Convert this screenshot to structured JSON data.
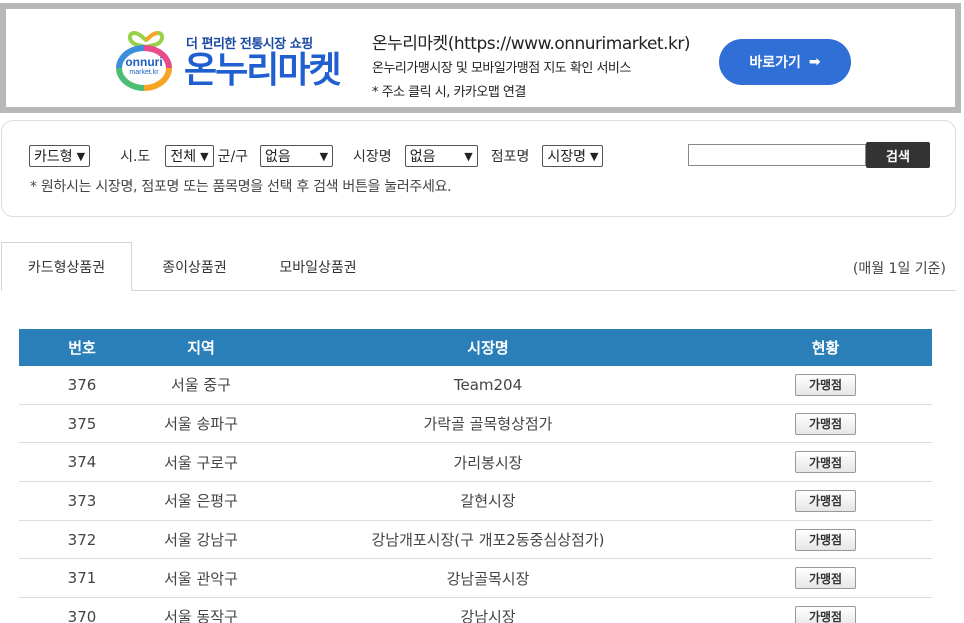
{
  "banner": {
    "logo_en": "onnuri",
    "logo_en_sub": "market.kr",
    "tagline": "더 편리한 전통시장 쇼핑",
    "brand": "온누리마켓",
    "info_title": "온누리마켓(https://www.onnurimarket.kr)",
    "info_sub": "온누리가맹시장 및 모바일가맹점 지도 확인 서비스",
    "info_note": "* 주소 클릭 시, 카카오맵 연결",
    "goto_label": "바로가기",
    "goto_arrow": "➡",
    "colors": {
      "brand": "#1f5fd0",
      "button": "#2f6fd6",
      "frame": "#b8b8b8"
    }
  },
  "search": {
    "type_select": "카드형",
    "sido_label": "시.도",
    "sido_select": "전체",
    "gugun_label": "군/구",
    "gugun_select": "없음",
    "market_label": "시장명",
    "market_select": "없음",
    "store_label": "점포명",
    "store_select": "시장명",
    "query_value": "",
    "button_label": "검색",
    "hint": "* 원하시는 시장명, 점포명 또는 품목명을 선택 후 검색 버튼을 눌러주세요."
  },
  "tabs": [
    {
      "label": "카드형상품권",
      "active": true
    },
    {
      "label": "종이상품권",
      "active": false
    },
    {
      "label": "모바일상품권",
      "active": false
    }
  ],
  "basis_note": "(매월 1일 기준)",
  "table": {
    "header_color": "#2b7fb8",
    "columns": [
      "번호",
      "지역",
      "시장명",
      "현황"
    ],
    "rows": [
      {
        "no": "376",
        "region": "서울 중구",
        "market": "Team204",
        "status": "가맹점"
      },
      {
        "no": "375",
        "region": "서울 송파구",
        "market": "가락골 골목형상점가",
        "status": "가맹점"
      },
      {
        "no": "374",
        "region": "서울 구로구",
        "market": "가리봉시장",
        "status": "가맹점"
      },
      {
        "no": "373",
        "region": "서울 은평구",
        "market": "갈현시장",
        "status": "가맹점"
      },
      {
        "no": "372",
        "region": "서울 강남구",
        "market": "강남개포시장(구 개포2동중심상점가)",
        "status": "가맹점"
      },
      {
        "no": "371",
        "region": "서울 관악구",
        "market": "강남골목시장",
        "status": "가맹점"
      },
      {
        "no": "370",
        "region": "서울 동작구",
        "market": "강남시장",
        "status": "가맹점"
      }
    ]
  }
}
